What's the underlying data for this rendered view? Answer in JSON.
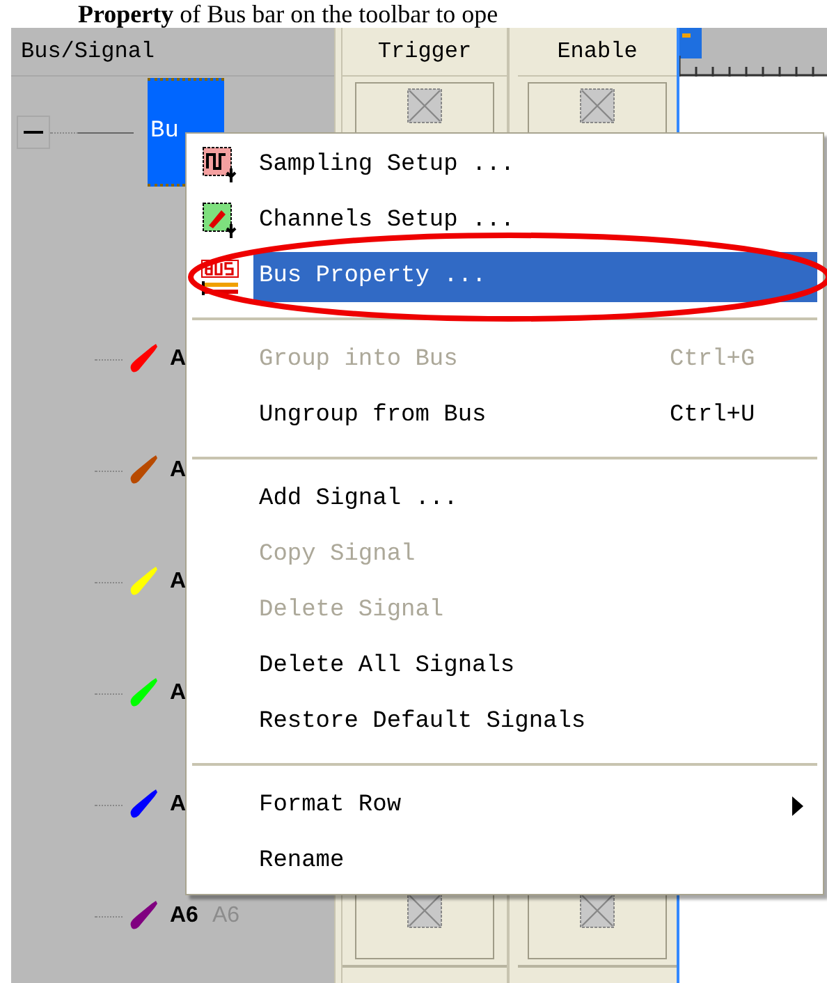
{
  "caption": "**Property** of Bus bar on the toolbar to ope",
  "columns": {
    "signal": "Bus/Signal",
    "trigger": "Trigger",
    "enable": "Enable"
  },
  "bus": {
    "label": "Bu",
    "selected": true,
    "expanded": true
  },
  "signals": [
    {
      "label": "A",
      "color": "#ff0000"
    },
    {
      "label": "A",
      "color": "#b84a00"
    },
    {
      "label": "A",
      "color": "#ffff00"
    },
    {
      "label": "A",
      "color": "#00ff00"
    },
    {
      "label": "A",
      "color": "#0000ff"
    },
    {
      "label": "A6",
      "alias": "A6",
      "color": "#800080"
    }
  ],
  "menu": {
    "items": [
      {
        "kind": "item",
        "label": "Sampling Setup ...",
        "disabled": false,
        "selected": false,
        "submenu": false
      },
      {
        "kind": "item",
        "label": "Channels Setup ...",
        "disabled": false,
        "selected": false,
        "submenu": false
      },
      {
        "kind": "item",
        "label": "Bus Property ...",
        "disabled": false,
        "selected": true,
        "submenu": false,
        "circled": true
      },
      {
        "kind": "separator"
      },
      {
        "kind": "item",
        "label": "Group into Bus",
        "shortcut": "Ctrl+G",
        "disabled": true,
        "selected": false,
        "submenu": false
      },
      {
        "kind": "item",
        "label": "Ungroup from Bus",
        "shortcut": "Ctrl+U",
        "disabled": false,
        "selected": false,
        "submenu": false
      },
      {
        "kind": "separator"
      },
      {
        "kind": "item",
        "label": "Add Signal ...",
        "disabled": false,
        "selected": false,
        "submenu": false
      },
      {
        "kind": "item",
        "label": "Copy Signal",
        "disabled": true,
        "selected": false,
        "submenu": false
      },
      {
        "kind": "item",
        "label": "Delete Signal",
        "disabled": true,
        "selected": false,
        "submenu": false
      },
      {
        "kind": "item",
        "label": "Delete All Signals",
        "disabled": false,
        "selected": false,
        "submenu": false
      },
      {
        "kind": "item",
        "label": "Restore Default Signals",
        "disabled": false,
        "selected": false,
        "submenu": false
      },
      {
        "kind": "separator"
      },
      {
        "kind": "item",
        "label": "Format Row",
        "disabled": false,
        "selected": false,
        "submenu": true
      },
      {
        "kind": "item",
        "label": "Rename",
        "disabled": false,
        "selected": false,
        "submenu": false
      }
    ]
  }
}
